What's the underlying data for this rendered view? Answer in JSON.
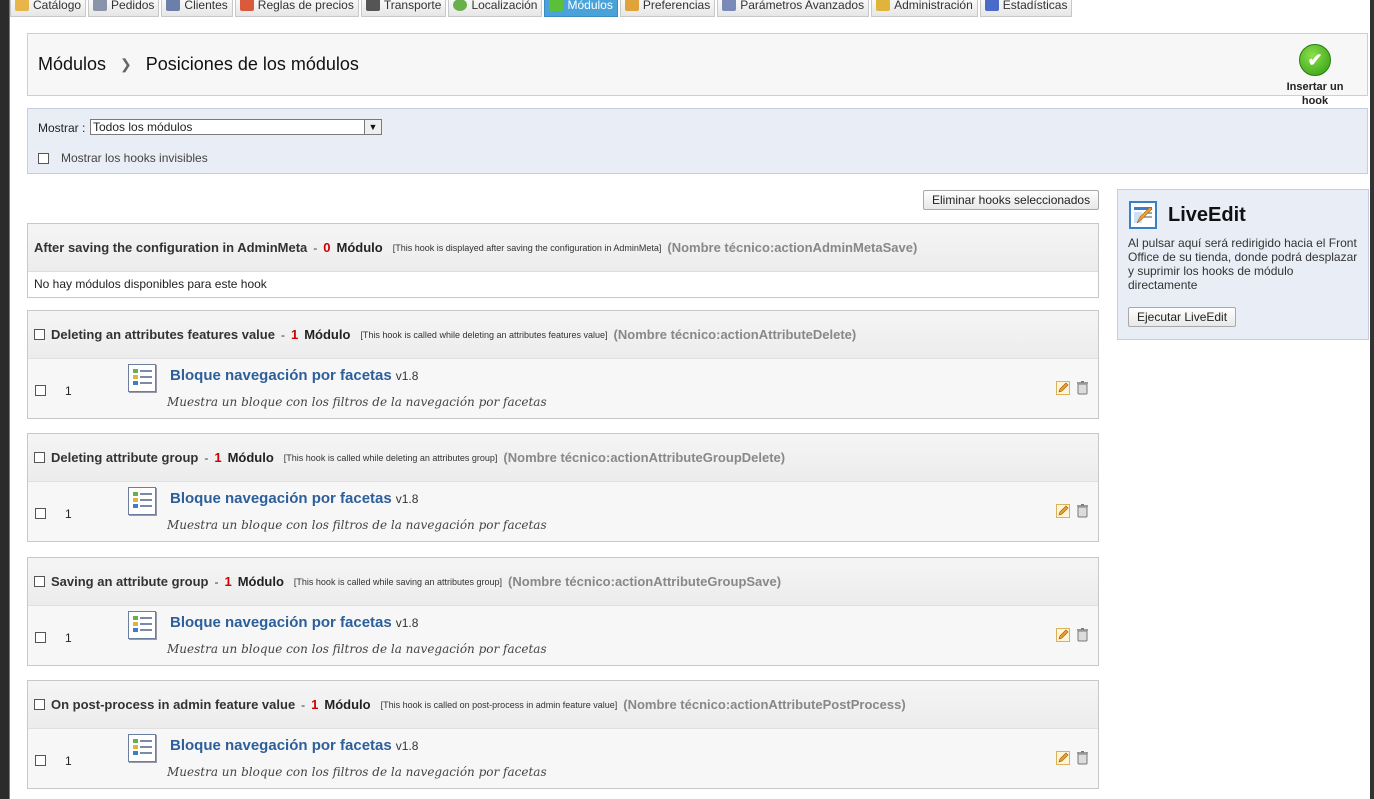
{
  "tabs": [
    {
      "label": "Catálogo",
      "icon": "folder-icon",
      "active": false,
      "color": "#e8b54a"
    },
    {
      "label": "Pedidos",
      "icon": "cart-icon",
      "active": false,
      "color": "#8a94a8"
    },
    {
      "label": "Clientes",
      "icon": "users-icon",
      "active": false,
      "color": "#6b7fa8"
    },
    {
      "label": "Reglas de precios",
      "icon": "price-rules-icon",
      "active": false,
      "color": "#d85a3a"
    },
    {
      "label": "Transporte",
      "icon": "truck-icon",
      "active": false,
      "color": "#555555"
    },
    {
      "label": "Localización",
      "icon": "globe-icon",
      "active": false,
      "color": "#6ab04a"
    },
    {
      "label": "Módulos",
      "icon": "puzzle-icon",
      "active": true,
      "color": "#5cbf3a"
    },
    {
      "label": "Preferencias",
      "icon": "preferences-icon",
      "active": false,
      "color": "#e0a23a"
    },
    {
      "label": "Parámetros Avanzados",
      "icon": "wrench-icon",
      "active": false,
      "color": "#7a8ab8"
    },
    {
      "label": "Administración",
      "icon": "key-icon",
      "active": false,
      "color": "#e0b43a"
    },
    {
      "label": "Estadísticas",
      "icon": "stats-icon",
      "active": false,
      "color": "#4a6ac8"
    }
  ],
  "breadcrumb": {
    "first": "Módulos",
    "second": "Posiciones de los módulos"
  },
  "insert_hook": {
    "label": "Insertar un hook",
    "icon": "check-circle-icon"
  },
  "filter": {
    "show_label": "Mostrar :",
    "selected": "Todos los módulos",
    "invisible_label": "Mostrar los hooks invisibles"
  },
  "delete_selected_label": "Eliminar hooks seleccionados",
  "hooks": [
    {
      "title": "After saving the configuration in AdminMeta",
      "count": "0",
      "module_word": "Módulo",
      "desc": "[This hook is displayed after saving the configuration in AdminMeta]",
      "tech": "(Nombre técnico:actionAdminMetaSave)",
      "empty": "No hay módulos disponibles para este hook",
      "has_checkbox": false
    },
    {
      "title": "Deleting an attributes features value",
      "count": "1",
      "module_word": "Módulo",
      "desc": "[This hook is called while deleting an attributes features value]",
      "tech": "(Nombre técnico:actionAttributeDelete)",
      "has_checkbox": true,
      "module": {
        "pos": "1",
        "name": "Bloque navegación por facetas",
        "version": "v1.8",
        "desc": "Muestra un bloque con los filtros de la navegación por facetas"
      }
    },
    {
      "title": "Deleting attribute group",
      "count": "1",
      "module_word": "Módulo",
      "desc": "[This hook is called while deleting an attributes group]",
      "tech": "(Nombre técnico:actionAttributeGroupDelete)",
      "has_checkbox": true,
      "module": {
        "pos": "1",
        "name": "Bloque navegación por facetas",
        "version": "v1.8",
        "desc": "Muestra un bloque con los filtros de la navegación por facetas"
      }
    },
    {
      "title": "Saving an attribute group",
      "count": "1",
      "module_word": "Módulo",
      "desc": "[This hook is called while saving an attributes group]",
      "tech": "(Nombre técnico:actionAttributeGroupSave)",
      "has_checkbox": true,
      "module": {
        "pos": "1",
        "name": "Bloque navegación por facetas",
        "version": "v1.8",
        "desc": "Muestra un bloque con los filtros de la navegación por facetas"
      }
    },
    {
      "title": "On post-process in admin feature value",
      "count": "1",
      "module_word": "Módulo",
      "desc": "[This hook is called on post-process in admin feature value]",
      "tech": "(Nombre técnico:actionAttributePostProcess)",
      "has_checkbox": true,
      "module": {
        "pos": "1",
        "name": "Bloque navegación por facetas",
        "version": "v1.8",
        "desc": "Muestra un bloque con los filtros de la navegación por facetas"
      }
    }
  ],
  "liveedit": {
    "title": "LiveEdit",
    "text": "Al pulsar aquí será redirigido hacia el Front Office de su tienda, donde podrá desplazar y suprimir los hooks de módulo directamente",
    "button": "Ejecutar LiveEdit"
  },
  "colors": {
    "accent": "#49a3d8",
    "module_link": "#2d5f9a",
    "count_red": "#cc0000",
    "panel_bg": "#e9edf5"
  }
}
